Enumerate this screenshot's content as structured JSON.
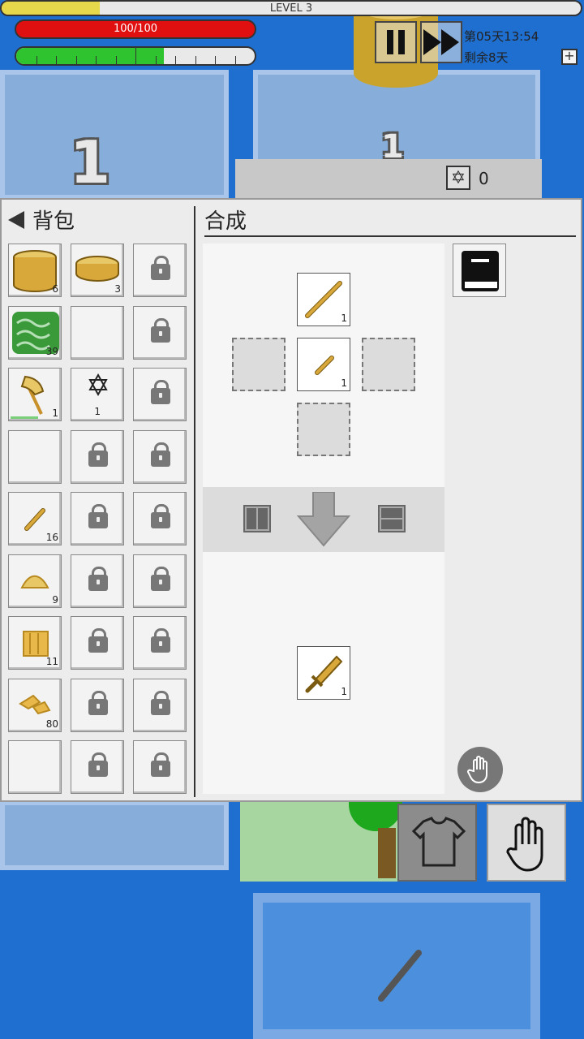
{
  "hud": {
    "level_label": "LEVEL 3",
    "xp_fraction": 0.17,
    "hp_label": "100/100",
    "stamina_fraction": 0.62,
    "day_text": "第05天13:54",
    "days_left_text": "剩余8天",
    "plus_label": "+",
    "counter_value": "0"
  },
  "background": {
    "tile_numbers": [
      "1",
      "1"
    ]
  },
  "inventory": {
    "title": "背包",
    "slots": [
      {
        "item": "log-icon",
        "count": "6"
      },
      {
        "item": "wood-disc-icon",
        "count": "3"
      },
      {
        "locked": true
      },
      {
        "item": "leaves-icon",
        "count": "39"
      },
      {
        "item": ""
      },
      {
        "locked": true
      },
      {
        "item": "axe-icon",
        "count": "1",
        "durability": 0.55
      },
      {
        "item": "star-of-david-icon",
        "count": "1"
      },
      {
        "locked": true
      },
      {
        "item": ""
      },
      {
        "locked": true
      },
      {
        "locked": true
      },
      {
        "item": "stick-icon",
        "count": "16"
      },
      {
        "locked": true
      },
      {
        "locked": true
      },
      {
        "item": "sawdust-icon",
        "count": "9"
      },
      {
        "locked": true
      },
      {
        "locked": true
      },
      {
        "item": "plank-icon",
        "count": "11"
      },
      {
        "locked": true
      },
      {
        "locked": true
      },
      {
        "item": "wood-chips-icon",
        "count": "80"
      },
      {
        "locked": true
      },
      {
        "locked": true
      },
      {
        "item": ""
      },
      {
        "locked": true
      },
      {
        "locked": true
      }
    ]
  },
  "crafting": {
    "title": "合成",
    "inputs": {
      "top": {
        "item": "long-stick-icon",
        "count": "1"
      },
      "center": {
        "item": "short-stick-icon",
        "count": "1"
      }
    },
    "output": {
      "item": "wooden-sword-icon",
      "count": "1"
    }
  },
  "colors": {
    "hp": "#e01010",
    "stamina": "#2fc42f",
    "xp": "#e6d84a",
    "wood": "#d9a83a",
    "water": "#1f6fd0"
  }
}
